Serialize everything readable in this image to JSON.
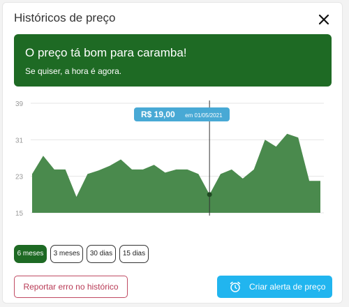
{
  "header": {
    "title": "Históricos de preço",
    "close_icon": "close-icon"
  },
  "banner": {
    "title": "O preço tá bom para caramba!",
    "subtitle": "Se quiser, a hora é agora.",
    "color": "#1e6a24"
  },
  "tooltip": {
    "price": "R$ 19,00",
    "date": "em 01/05/2021",
    "color": "#48a9d5"
  },
  "chart_data": {
    "type": "area",
    "y_ticks": [
      "39",
      "31",
      "23",
      "15"
    ],
    "ylim": [
      15,
      39
    ],
    "values": [
      23.5,
      27.5,
      24.5,
      24.5,
      18.5,
      23.5,
      24.3,
      25.3,
      26.7,
      24.5,
      24.5,
      25.5,
      23.8,
      24.5,
      24.5,
      23.5,
      19,
      23.5,
      24.5,
      22.5,
      24.5,
      31,
      29.5,
      32.3,
      31.5,
      22,
      22
    ],
    "highlight_index": 16,
    "fill_color": "#4a8a4d",
    "grid": true
  },
  "periods": [
    {
      "label": "6 meses",
      "active": true
    },
    {
      "label": "3 meses",
      "active": false
    },
    {
      "label": "30 dias",
      "active": false
    },
    {
      "label": "15 dias",
      "active": false
    }
  ],
  "actions": {
    "report_label": "Reportar erro no histórico",
    "alert_label": "Criar alerta de preço",
    "alert_icon": "alarm-clock-icon",
    "alert_color": "#21b5ef",
    "report_color": "#b83a55"
  }
}
